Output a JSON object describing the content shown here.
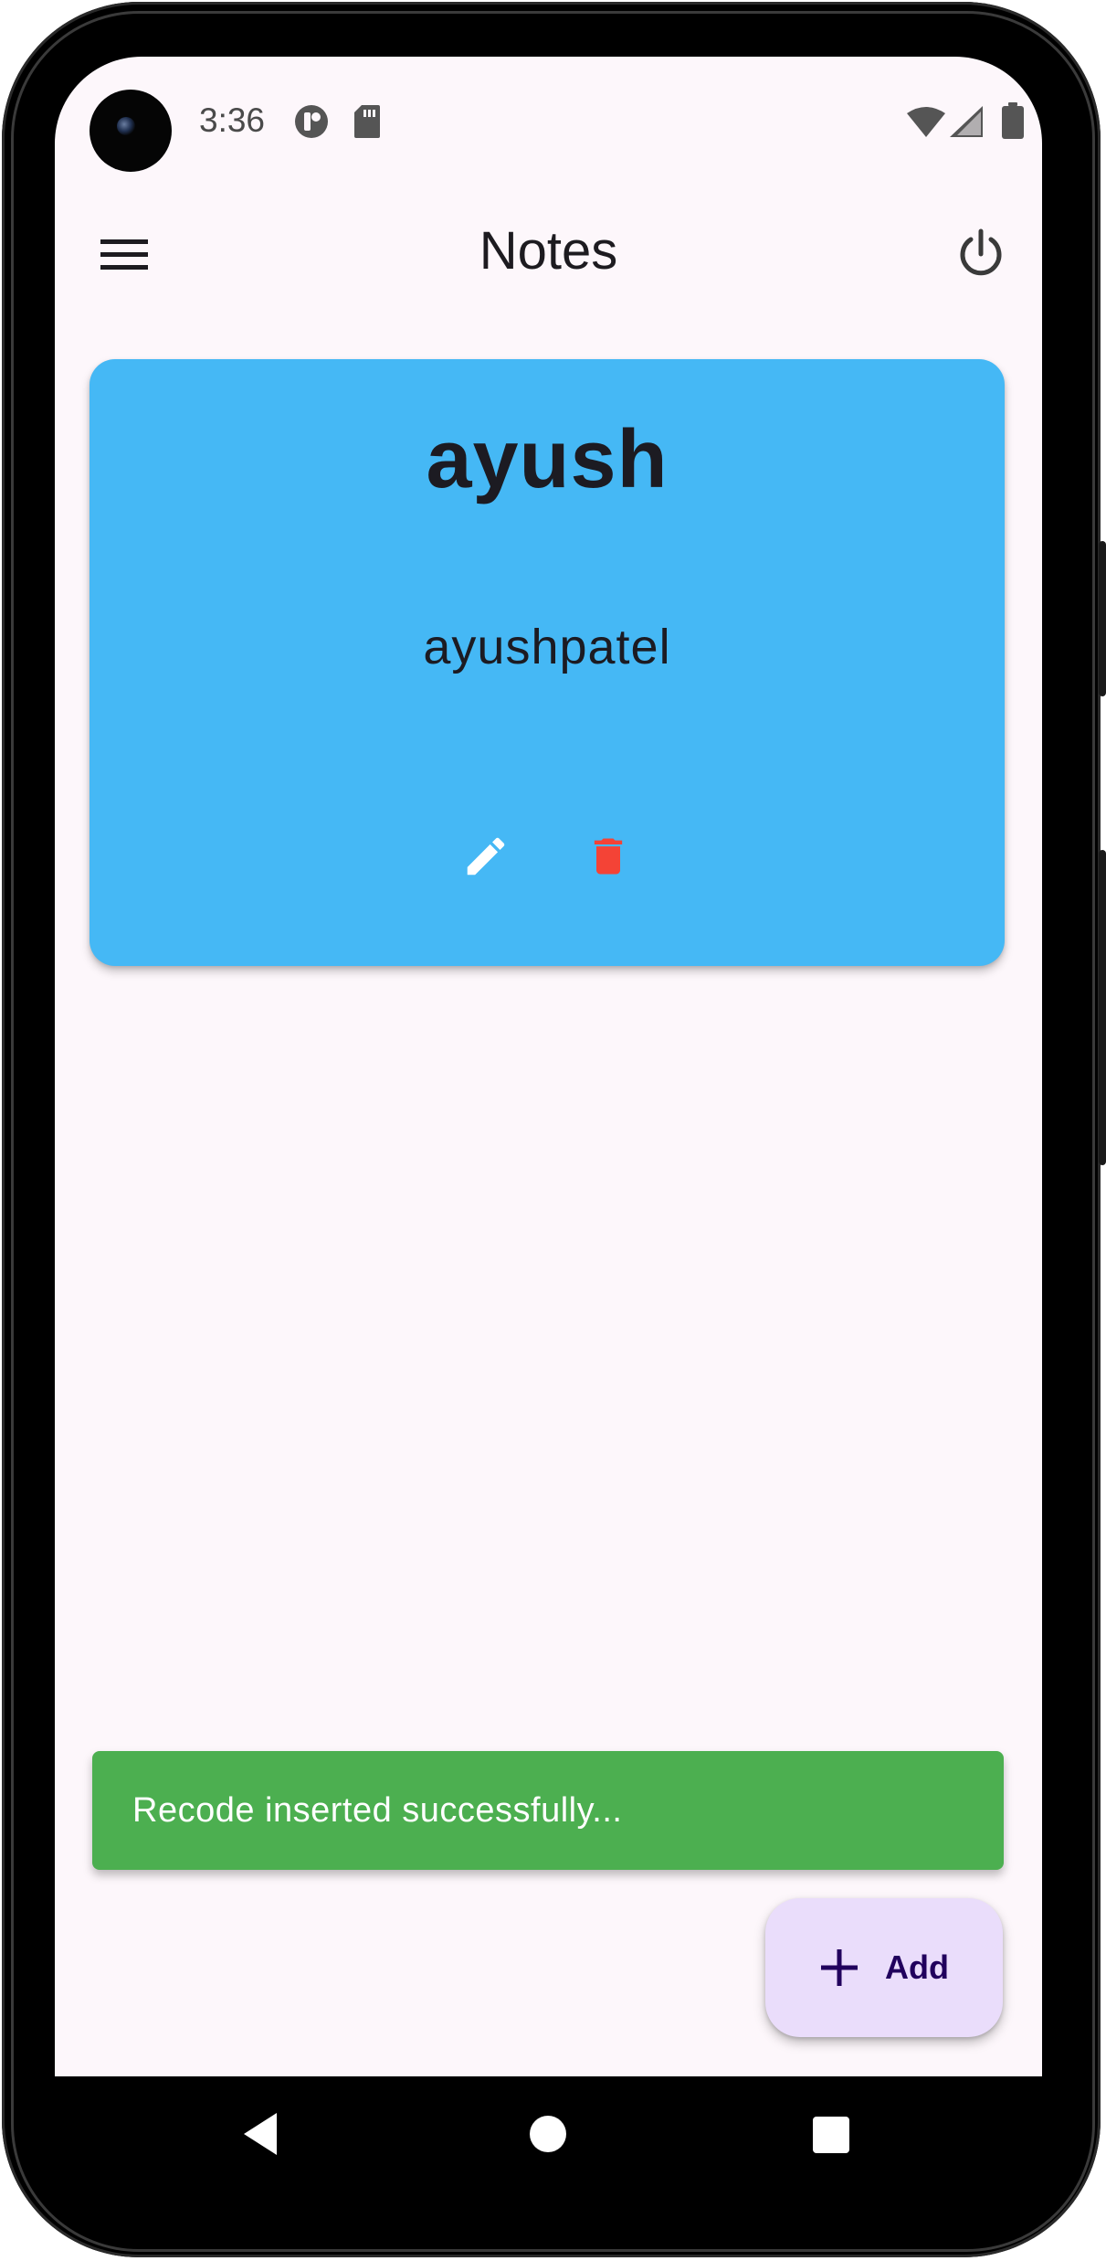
{
  "status_bar": {
    "time": "3:36",
    "icons": [
      "camera-icon",
      "notification-app-icon",
      "sd-card-icon",
      "wifi-icon",
      "cell-signal-icon",
      "battery-icon"
    ]
  },
  "app_bar": {
    "title": "Notes",
    "menu_icon": "hamburger-menu-icon",
    "logout_icon": "power-icon"
  },
  "notes": [
    {
      "title": "ayush",
      "body": "ayushpatel",
      "color": "#45b8f5",
      "actions": [
        "edit-icon",
        "delete-icon"
      ]
    }
  ],
  "snackbar": {
    "message": "Recode inserted successfully...",
    "color": "#4caf50"
  },
  "fab": {
    "label": "Add",
    "icon": "plus-icon",
    "color": "#eaddfb"
  },
  "colors": {
    "screen_background": "#fdf7fb",
    "delete_icon": "#f44336",
    "edit_icon": "#ffffff"
  },
  "nav_bar": {
    "buttons": [
      "back-icon",
      "home-icon",
      "recents-icon"
    ]
  }
}
